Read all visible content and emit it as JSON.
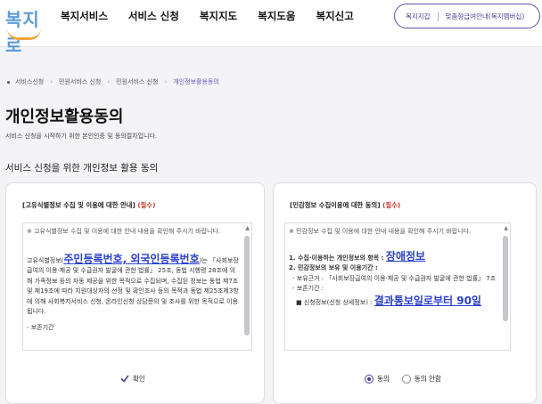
{
  "logo": {
    "text": "복지로"
  },
  "nav": {
    "items": [
      "복지서비스",
      "서비스 신청",
      "복지지도",
      "복지도움",
      "복지신고"
    ]
  },
  "header_links": {
    "link1": "복지지갑",
    "link2": "맞춤형급여안내(복지멤버십)"
  },
  "breadcrumb": {
    "items": [
      "서비스신청",
      "민원서비스 신청",
      "민원서비스 신청"
    ],
    "current": "개인정보활용동의"
  },
  "page": {
    "title": "개인정보활용동의",
    "subtitle": "서비스 신청을 시작하기 위한 본인인증 및 동의절차입니다.",
    "section_title": "서비스 신청을 위한 개인정보 활용 동의"
  },
  "left_card": {
    "title": "[고유식별정보 수집 및 이용에 대한 안내]",
    "required": "(필수)",
    "notice": "※ 고유식별정보 수집 및 이용에 대한 안내 내용을 확인해 주시기 바랍니다.",
    "body_prefix": "고유식별정보(",
    "body_highlight": "주민등록번호, 외국인등록번호",
    "body_suffix": ")는",
    "body_rest": "「사회보장급여의 이용·제공 및 수급권자 발굴에 관한 법률」 25조, 동법 시행령 28조에 의해 가족정보 등의 자동 제공을 위한 목적으로 수집되며, 수집된 정보는 동법 제7조 및 제19조에 따라 지원대상자의 선정 및 확인조사 등의 목적과 동법 제25조제3항에 의해 사회복지서비스 신청, 온라인신청 상담문의 및 조사를 위한 목적으로 이용됩니다.",
    "retention": "- 보존기간",
    "confirm_label": "확인"
  },
  "right_card": {
    "title": "[민감정보 수집이용에 대한 동의]",
    "required": "(필수)",
    "notice": "※ 민감정보 수집 및 이용에 대한 안내 내용을 확인해 주시기 바랍니다.",
    "item1_prefix": "1. 수집·이용하는 개인정보의 항목 : ",
    "item1_highlight": "장애정보",
    "item2": "2. 민감정보의 보유 및 이용기간 :",
    "basis": "- 보유근거 : 「사회보장급여의 이용·제공 및 수급권자 발굴에 관한 법률」 7조",
    "retention": "- 보존기간 :",
    "period_prefix": "■ 신청정보(신청 상세정보) : ",
    "period_highlight": "결과통보일로부터 90일",
    "agree_label": "동의",
    "disagree_label": "동의 안함"
  }
}
